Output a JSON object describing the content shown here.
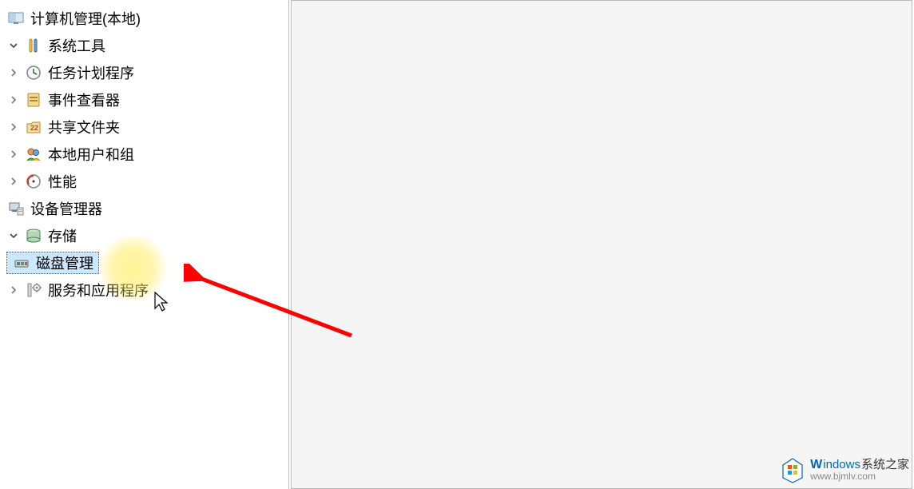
{
  "tree": {
    "root": {
      "label": "计算机管理(本地)"
    },
    "systemTools": {
      "label": "系统工具"
    },
    "taskScheduler": {
      "label": "任务计划程序"
    },
    "eventViewer": {
      "label": "事件查看器"
    },
    "sharedFolders": {
      "label": "共享文件夹"
    },
    "localUsers": {
      "label": "本地用户和组"
    },
    "performance": {
      "label": "性能"
    },
    "deviceManager": {
      "label": "设备管理器"
    },
    "storage": {
      "label": "存储"
    },
    "diskManagement": {
      "label": "磁盘管理"
    },
    "services": {
      "label": "服务和应用程序"
    }
  },
  "watermark": {
    "brand_w": "W",
    "brand_rest": "indows",
    "brand_cn": "系统之家",
    "url": "www.bjmlv.com"
  }
}
